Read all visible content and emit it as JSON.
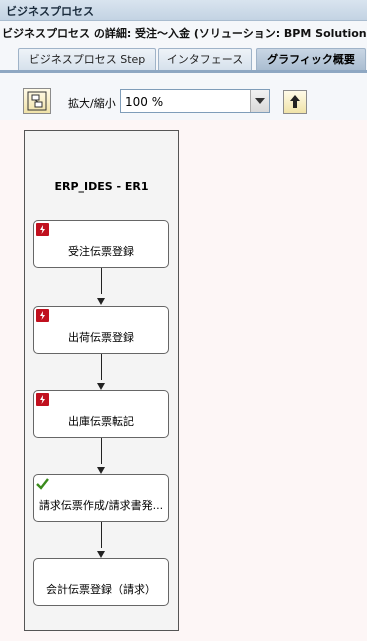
{
  "window": {
    "title": "ビジネスプロセス"
  },
  "header": {
    "subtitle": "ビジネスプロセス の詳細: 受注～入金 (ソリューション: BPM Solution)"
  },
  "tabs": [
    {
      "label": "ビジネスプロセス Step",
      "active": false
    },
    {
      "label": "インタフェース",
      "active": false
    },
    {
      "label": "グラフィック概要",
      "active": true
    }
  ],
  "toolbar": {
    "zoom_label": "拡大/縮小",
    "zoom_value": "100 %"
  },
  "diagram": {
    "pool_title": "ERP_IDES - ER1",
    "steps": [
      {
        "label": "受注伝票登録",
        "status_icon": "error-icon"
      },
      {
        "label": "出荷伝票登録",
        "status_icon": "error-icon"
      },
      {
        "label": "出庫伝票転記",
        "status_icon": "error-icon"
      },
      {
        "label": "請求伝票作成/請求書発...",
        "status_icon": "checkmark-icon"
      },
      {
        "label": "会計伝票登録（請求）",
        "status_icon": ""
      }
    ]
  },
  "colors": {
    "error": "#c0101e",
    "ok": "#3a8a1c",
    "canvas": "#fdf6f6"
  }
}
